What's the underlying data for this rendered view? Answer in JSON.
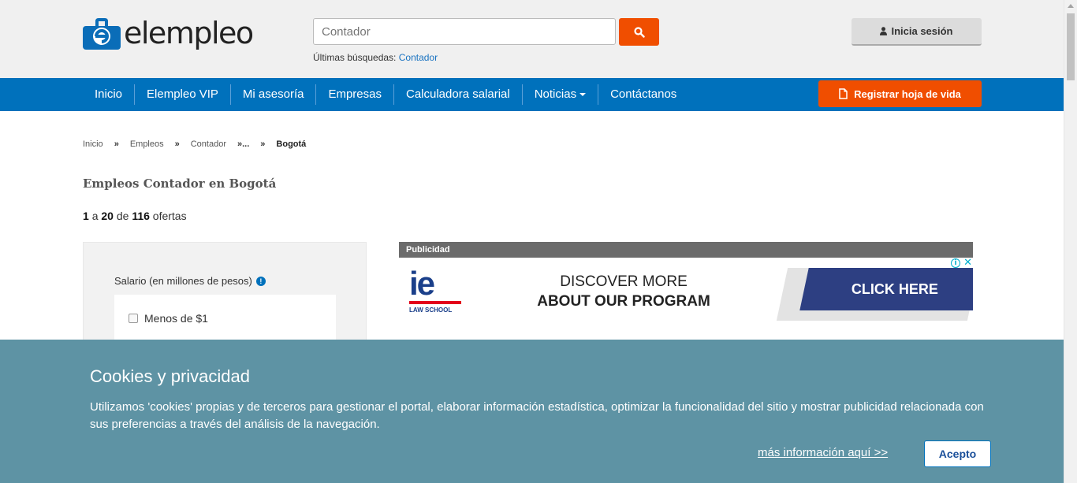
{
  "header": {
    "logo_text": "elempleo",
    "search": {
      "placeholder": "Contador",
      "value": ""
    },
    "recent_label": "Últimas búsquedas:",
    "recent_link": "Contador",
    "login_label": "Inicia sesión"
  },
  "nav": {
    "items": [
      {
        "label": "Inicio"
      },
      {
        "label": "Elempleo VIP"
      },
      {
        "label": "Mi asesoría"
      },
      {
        "label": "Empresas"
      },
      {
        "label": "Calculadora salarial"
      },
      {
        "label": "Noticias"
      },
      {
        "label": "Contáctanos"
      }
    ],
    "register_label": "Registrar hoja de vida"
  },
  "breadcrumb": {
    "items": [
      "Inicio",
      "Empleos",
      "Contador",
      "Bogotá"
    ],
    "separator": "»",
    "ellipsis": "»..."
  },
  "main": {
    "title": "Empleos Contador en Bogotá",
    "results": {
      "from": "1",
      "a": "a",
      "to": "20",
      "de": "de",
      "total": "116",
      "suffix": "ofertas"
    }
  },
  "filters": {
    "salary_label": "Salario (en millones de pesos)",
    "info_glyph": "!",
    "options": [
      "Menos de $1"
    ]
  },
  "ad": {
    "label": "Publicidad",
    "logo_text": "ie",
    "logo_sub": "LAW SCHOOL",
    "line1": "DISCOVER MORE",
    "line2": "ABOUT OUR PROGRAM",
    "cta": "CLICK HERE",
    "adchoices_i": "i",
    "adchoices_x": "✕"
  },
  "cookie": {
    "title": "Cookies y privacidad",
    "text": "Utilizamos 'cookies' propias y de terceros para gestionar el portal, elaborar información estadística, optimizar la funcionalidad del sitio y mostrar publicidad relacionada con sus preferencias a través del análisis de la navegación.",
    "more_link": "más información aquí >>",
    "accept": "Acepto"
  },
  "colors": {
    "brand_blue": "#0071bc",
    "accent_orange": "#f04e00",
    "cookie_bg": "#5e93a4"
  }
}
